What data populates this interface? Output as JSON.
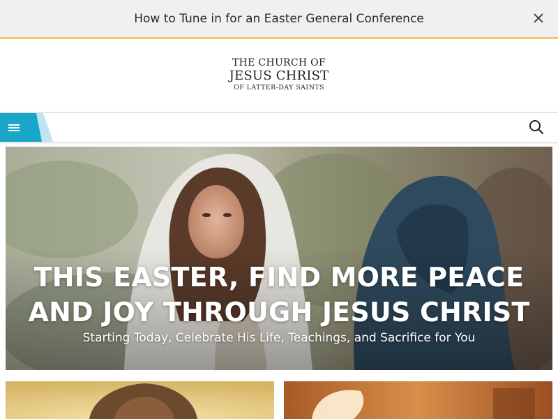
{
  "announcement": {
    "text": "How to Tune in for an Easter General Conference",
    "close_icon": "close-icon",
    "accent_color": "#f5c56b"
  },
  "logo": {
    "line1": "THE CHURCH OF",
    "line2": "JESUS CHRIST",
    "line3": "OF LATTER-DAY SAINTS"
  },
  "nav": {
    "menu_icon": "hamburger-menu-icon",
    "menu_color": "#1aa6c8",
    "search_icon": "search-icon"
  },
  "hero": {
    "title_line1": "THIS EASTER, FIND MORE PEACE",
    "title_line2": "AND JOY THROUGH JESUS CHRIST",
    "subtitle": "Starting Today, Celebrate His Life, Teachings, and Sacrifice for You"
  },
  "cards": [
    {
      "image": "painting-of-christ-card-image"
    },
    {
      "image": "empty-tomb-card-image"
    }
  ]
}
